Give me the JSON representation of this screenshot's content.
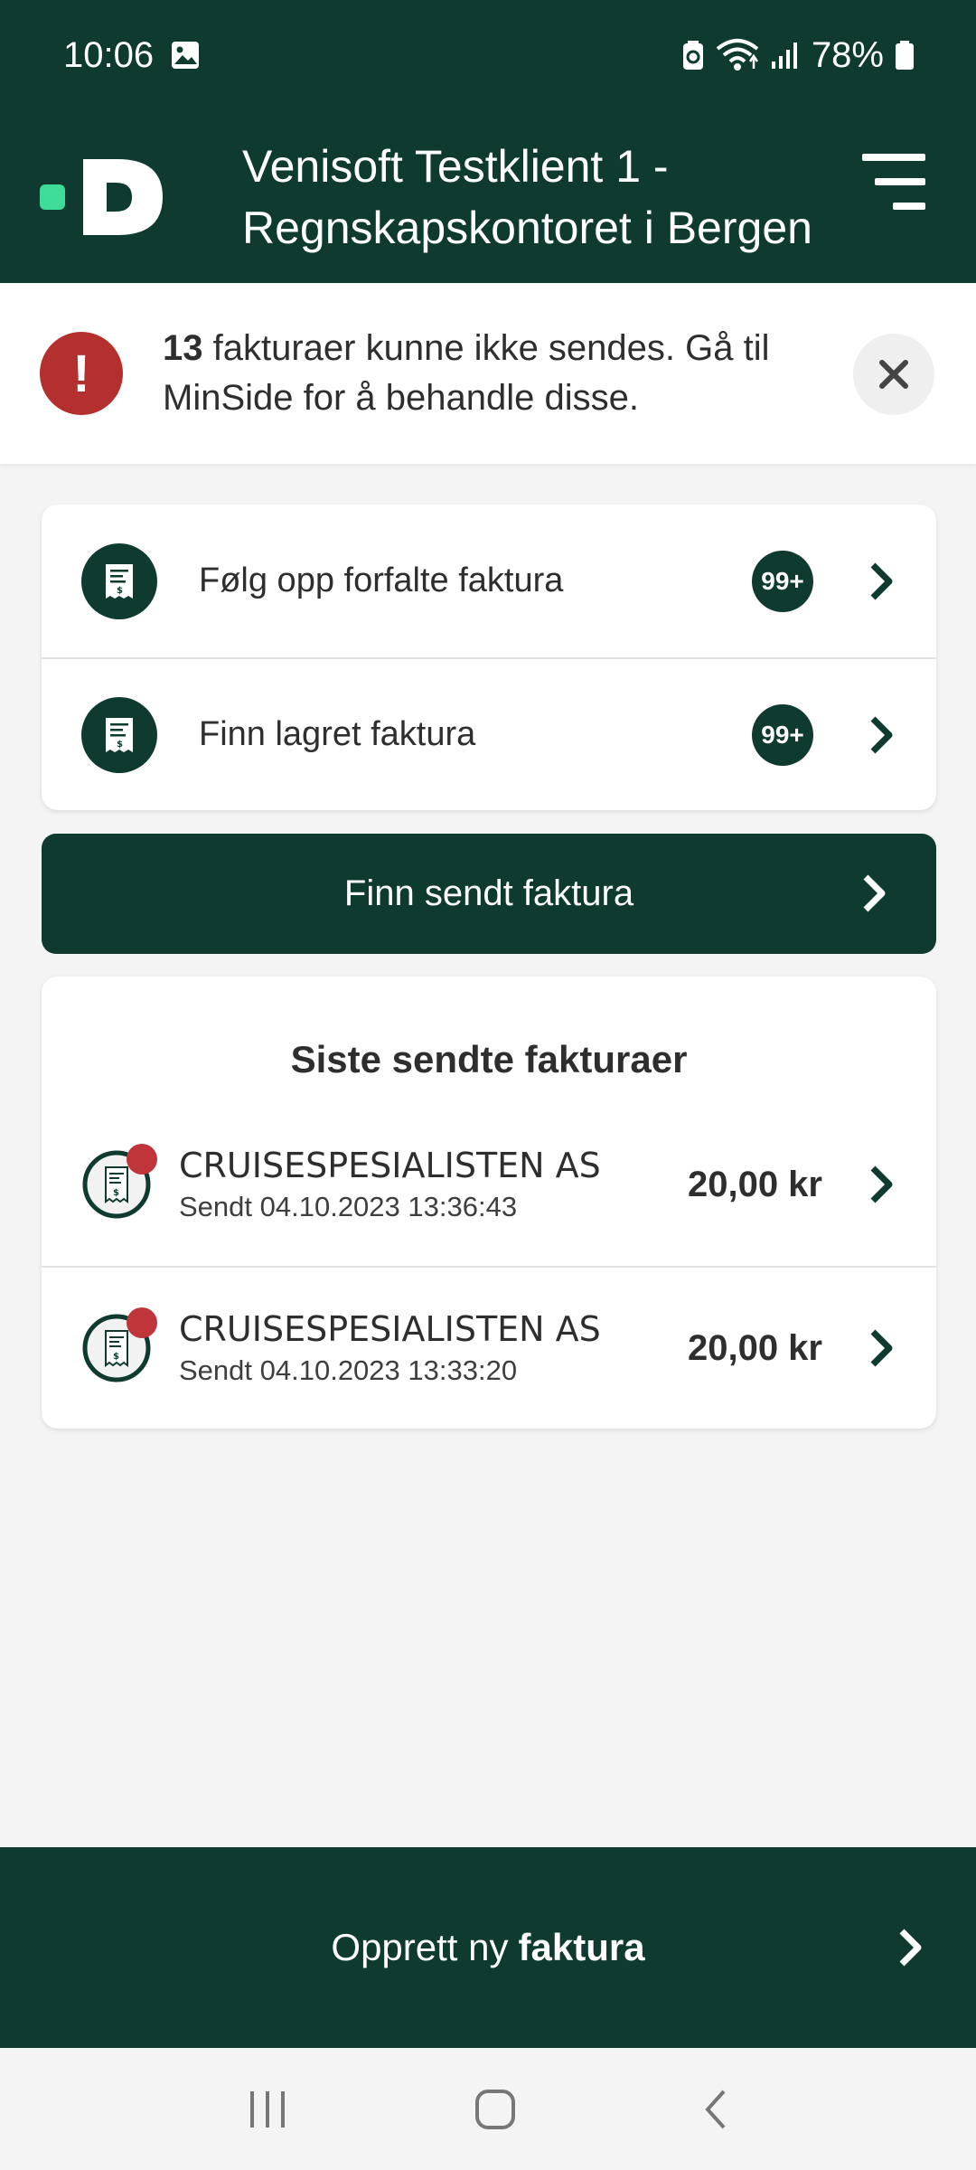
{
  "status": {
    "time": "10:06",
    "battery": "78%"
  },
  "header": {
    "title_line1": "Venisoft Testklient 1 -",
    "title_line2": "Regnskapskontoret i Bergen"
  },
  "alert": {
    "count": "13",
    "message_rest": " fakturaer kunne ikke sendes. Gå til MinSide for å behandle disse."
  },
  "actions": [
    {
      "label": "Følg opp forfalte faktura",
      "badge": "99+"
    },
    {
      "label": "Finn lagret faktura",
      "badge": "99+"
    }
  ],
  "primary_button": {
    "label": "Finn sendt faktura"
  },
  "recent": {
    "title": "Siste sendte fakturaer",
    "items": [
      {
        "name": "CRUISESPESIALISTEN AS",
        "sent": "Sendt 04.10.2023 13:36:43",
        "amount": "20,00 kr"
      },
      {
        "name": "CRUISESPESIALISTEN AS",
        "sent": "Sendt 04.10.2023 13:33:20",
        "amount": "20,00 kr"
      }
    ]
  },
  "bottom_button": {
    "prefix": "Opprett ny",
    "bold": "faktura"
  },
  "colors": {
    "brand_green": "#0e3a30",
    "accent_mint": "#3ddc97",
    "alert_red": "#b3302f",
    "background": "#f4f4f4"
  }
}
